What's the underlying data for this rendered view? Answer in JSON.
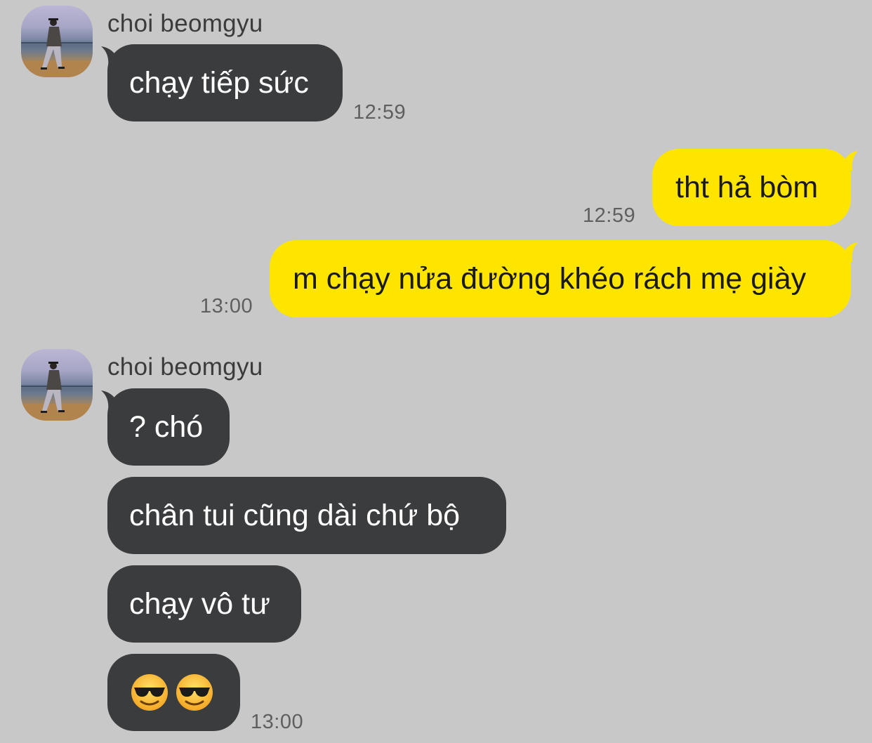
{
  "conversation": {
    "groups": [
      {
        "sender": "choi beomgyu",
        "messages": [
          {
            "text": "chạy tiếp sức",
            "time": "12:59"
          }
        ]
      },
      {
        "outgoing": [
          {
            "text": "tht hả bòm",
            "time": "12:59"
          },
          {
            "text": "m chạy nửa đường khéo rách mẹ giày",
            "time": "13:00"
          }
        ]
      },
      {
        "sender": "choi beomgyu",
        "messages": [
          {
            "text": "? chó"
          },
          {
            "text": "chân tui cũng dài chứ bộ"
          },
          {
            "text": "chạy vô tư"
          },
          {
            "text": "😎😎",
            "time": "13:00",
            "emoji": [
              "smiling-face-with-sunglasses",
              "smiling-face-with-sunglasses"
            ]
          }
        ]
      }
    ]
  },
  "colors": {
    "background": "#c8c8c8",
    "incoming_bubble": "#3b3c3e",
    "outgoing_bubble": "#fee500",
    "timestamp": "#5f5f5f"
  }
}
